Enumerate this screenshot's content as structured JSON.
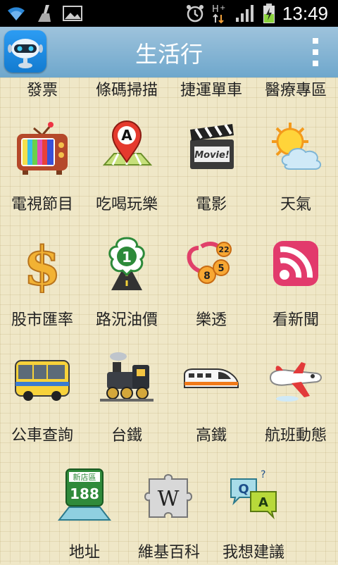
{
  "status": {
    "time": "13:49"
  },
  "appbar": {
    "title": "生活行"
  },
  "rows": [
    {
      "labels": [
        "發票",
        "條碼掃描",
        "捷運單車",
        "醫療專區"
      ]
    },
    {
      "labels": [
        "電視節目",
        "吃喝玩樂",
        "電影",
        "天氣"
      ]
    },
    {
      "labels": [
        "股市匯率",
        "路況油價",
        "樂透",
        "看新聞"
      ]
    },
    {
      "labels": [
        "公車查詢",
        "台鐵",
        "高鐵",
        "航班動態"
      ]
    },
    {
      "labels": [
        "地址",
        "維基百科",
        "我想建議"
      ]
    }
  ],
  "icons": {
    "movie_text": "Movie!",
    "pin_letter": "A",
    "route_number": "1",
    "lotto_balls": [
      "8",
      "5",
      "22"
    ],
    "address_sign_top": "新店區",
    "address_sign_number": "188",
    "wiki_letter": "W",
    "qa_q": "Q",
    "qa_a": "A"
  }
}
